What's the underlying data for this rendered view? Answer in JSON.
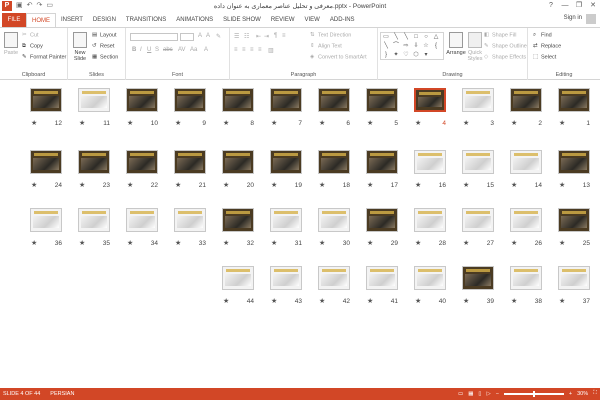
{
  "window": {
    "title": "معرفی و تحلیل عناصر معماری به عنوان داده.pptx - PowerPoint",
    "controls": [
      "?",
      "—",
      "❐",
      "✕"
    ]
  },
  "tabs": [
    "FILE",
    "HOME",
    "INSERT",
    "DESIGN",
    "TRANSITIONS",
    "ANIMATIONS",
    "SLIDE SHOW",
    "REVIEW",
    "VIEW",
    "ADD-INS"
  ],
  "active_tab": "HOME",
  "signin": "Sign in",
  "ribbon": {
    "clipboard": {
      "label": "Clipboard",
      "paste": "Paste",
      "cut": "Cut",
      "copy": "Copy",
      "format_painter": "Format Painter"
    },
    "slides": {
      "label": "Slides",
      "new_slide": "New\nSlide",
      "layout": "Layout",
      "reset": "Reset",
      "section": "Section"
    },
    "font": {
      "label": "Font"
    },
    "paragraph": {
      "label": "Paragraph",
      "text_direction": "Text Direction",
      "align_text": "Align Text",
      "convert_smartart": "Convert to SmartArt"
    },
    "drawing": {
      "label": "Drawing",
      "arrange": "Arrange",
      "quick_styles": "Quick Styles",
      "shape_fill": "Shape Fill",
      "shape_outline": "Shape Outline",
      "shape_effects": "Shape Effects"
    },
    "editing": {
      "label": "Editing",
      "find": "Find",
      "replace": "Replace",
      "select": "Select"
    }
  },
  "slides": [
    {
      "n": "12"
    },
    {
      "n": "11"
    },
    {
      "n": "10"
    },
    {
      "n": "9"
    },
    {
      "n": "8"
    },
    {
      "n": "7"
    },
    {
      "n": "6"
    },
    {
      "n": "5"
    },
    {
      "n": "4"
    },
    {
      "n": "3"
    },
    {
      "n": "2"
    },
    {
      "n": "1"
    },
    {
      "n": "24"
    },
    {
      "n": "23"
    },
    {
      "n": "22"
    },
    {
      "n": "21"
    },
    {
      "n": "20"
    },
    {
      "n": "19"
    },
    {
      "n": "18"
    },
    {
      "n": "17"
    },
    {
      "n": "16"
    },
    {
      "n": "15"
    },
    {
      "n": "14"
    },
    {
      "n": "13"
    },
    {
      "n": "36"
    },
    {
      "n": "35"
    },
    {
      "n": "34"
    },
    {
      "n": "33"
    },
    {
      "n": "32"
    },
    {
      "n": "31"
    },
    {
      "n": "30"
    },
    {
      "n": "29"
    },
    {
      "n": "28"
    },
    {
      "n": "27"
    },
    {
      "n": "26"
    },
    {
      "n": "25"
    },
    {
      "n": "44"
    },
    {
      "n": "43"
    },
    {
      "n": "42"
    },
    {
      "n": "41"
    },
    {
      "n": "40"
    },
    {
      "n": "39"
    },
    {
      "n": "38"
    },
    {
      "n": "37"
    }
  ],
  "selected_slide": "4",
  "star": "★",
  "status": {
    "slide": "SLIDE 4 OF 44",
    "language": "PERSIAN",
    "zoom": "30%"
  },
  "colors": {
    "accent": "#d24726"
  }
}
